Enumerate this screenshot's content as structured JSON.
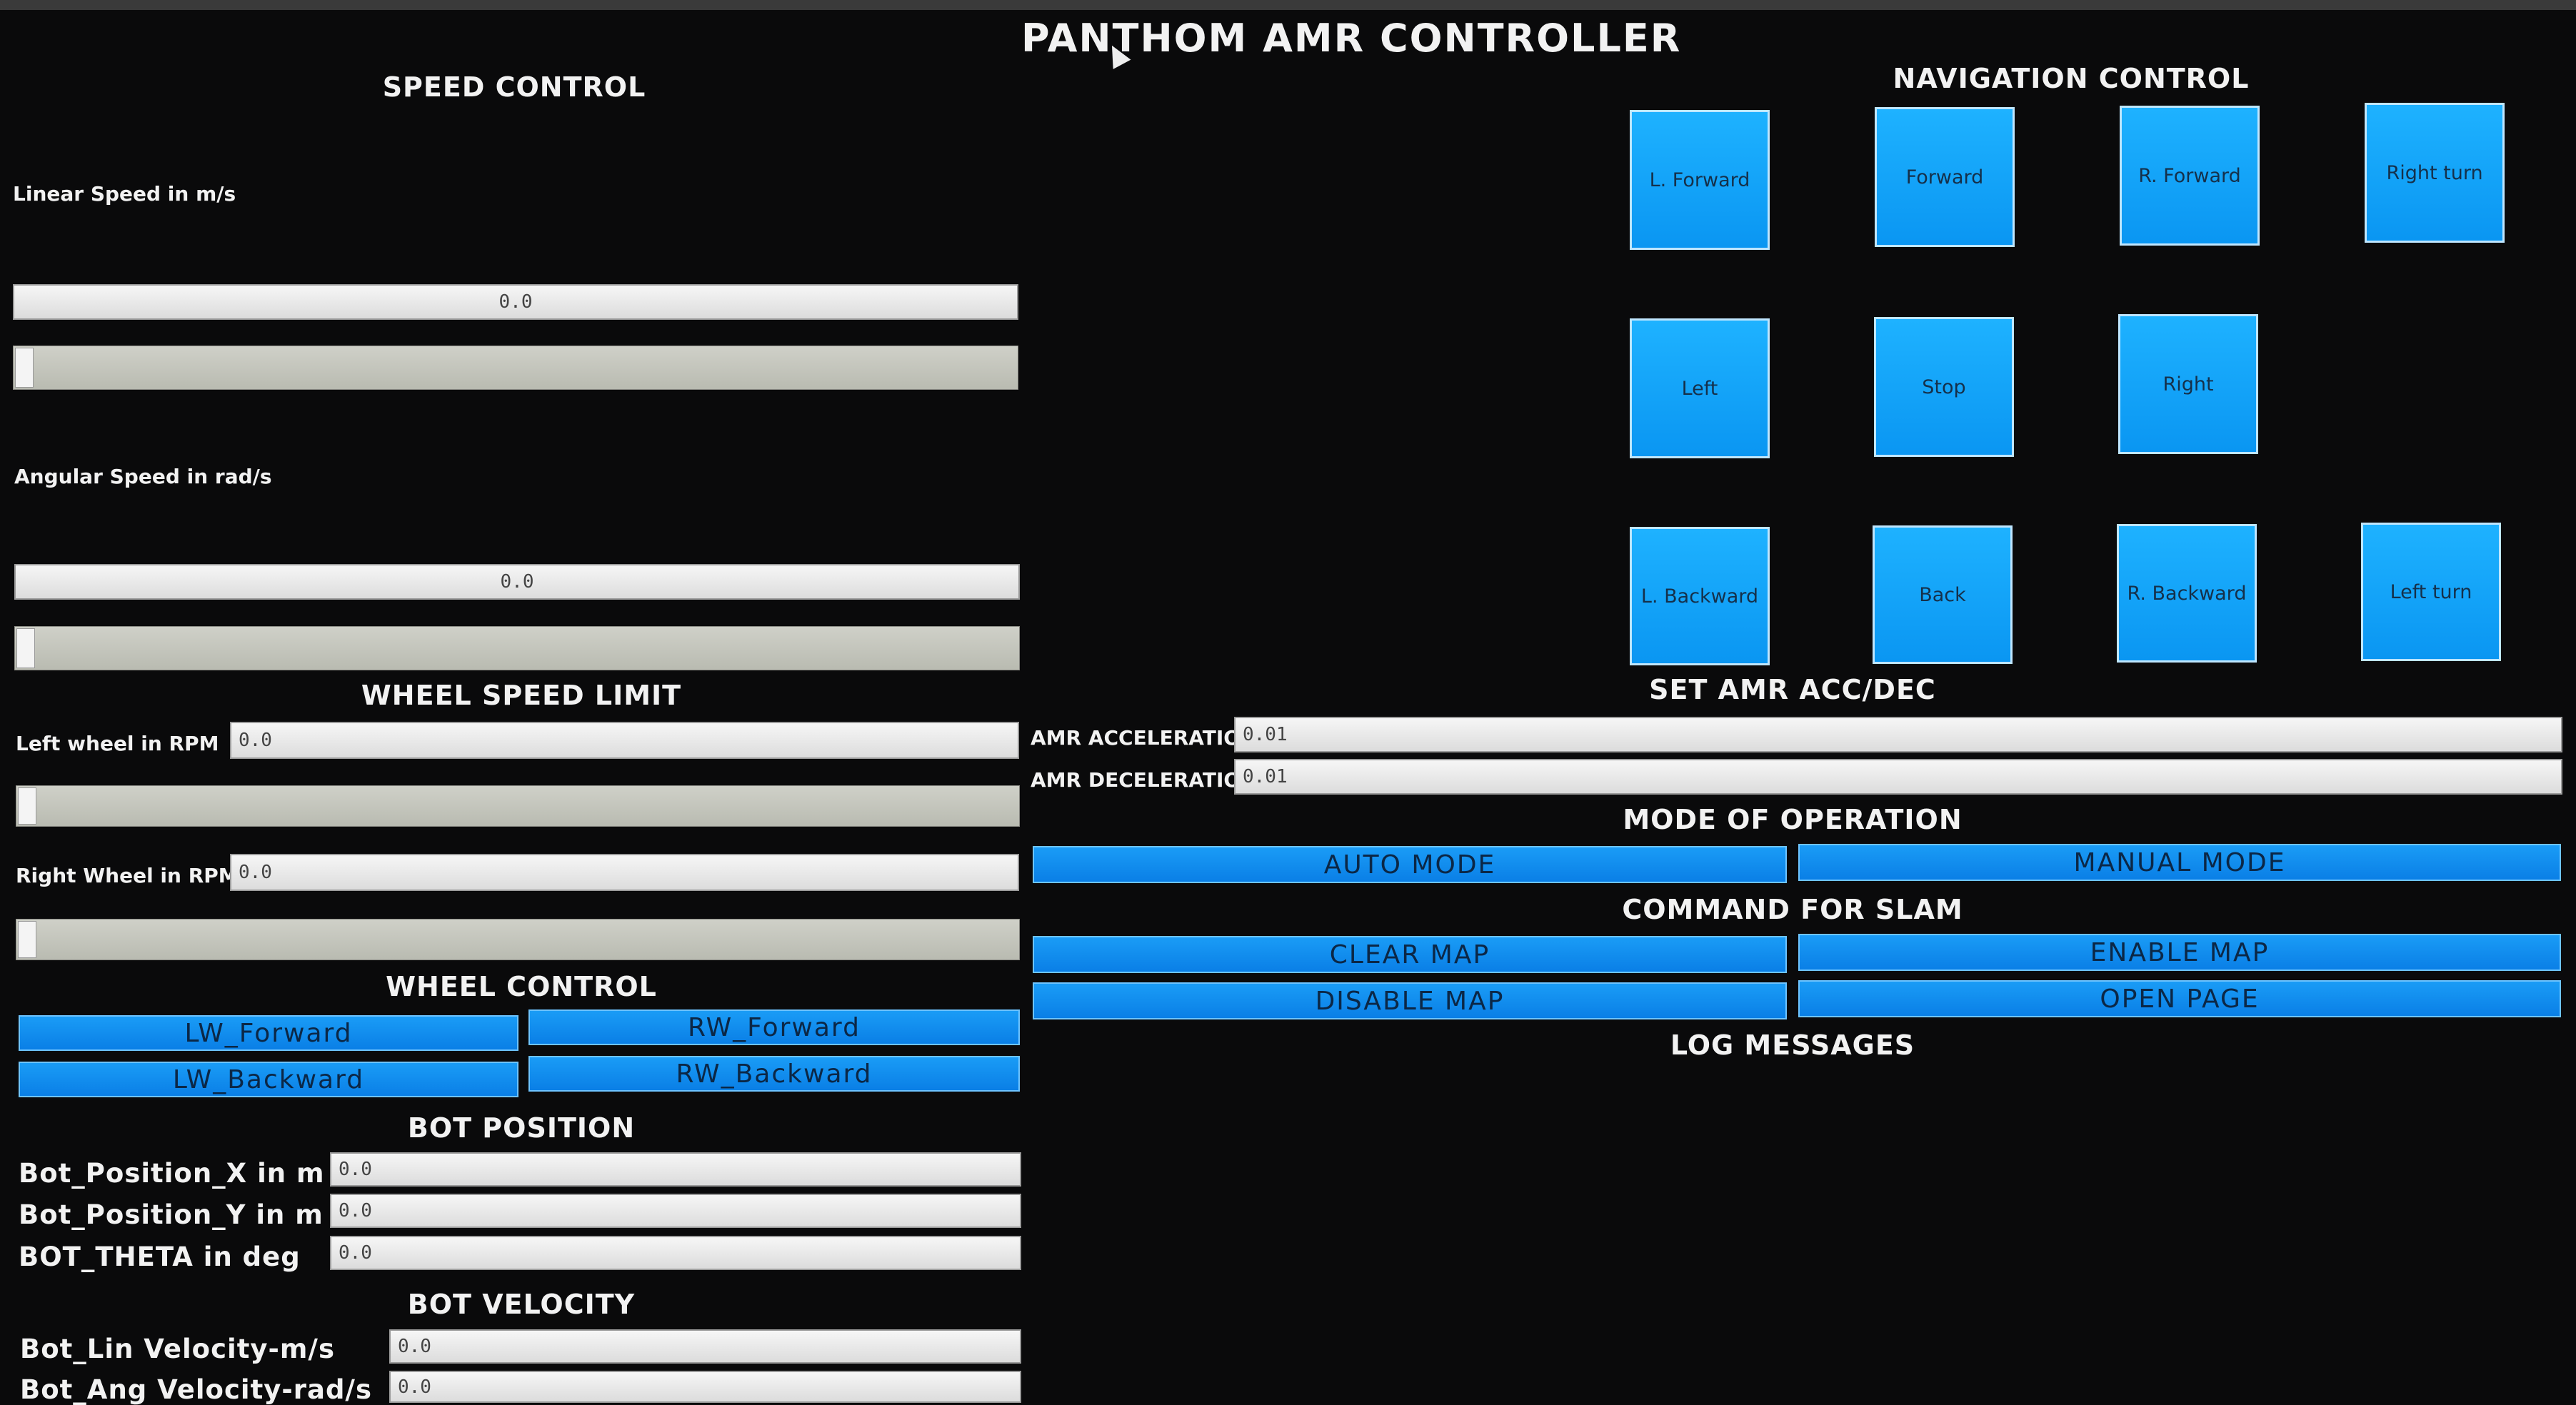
{
  "app": {
    "title": "PANTHOM AMR CONTROLLER"
  },
  "speed_control": {
    "heading": "SPEED CONTROL",
    "linear": {
      "label": "Linear Speed in m/s",
      "value": "0.0",
      "slider_fraction": 0.0
    },
    "angular": {
      "label": "Angular Speed in rad/s",
      "value": "0.0",
      "slider_fraction": 0.0
    }
  },
  "wheel_speed_limit": {
    "heading": "WHEEL SPEED LIMIT",
    "left": {
      "label": "Left wheel in RPM",
      "value": "0.0",
      "slider_fraction": 0.0
    },
    "right": {
      "label": "Right Wheel in RPM",
      "value": "0.0",
      "slider_fraction": 0.0
    }
  },
  "wheel_control": {
    "heading": "WHEEL CONTROL",
    "lw_forward": "LW_Forward",
    "rw_forward": "RW_Forward",
    "lw_backward": "LW_Backward",
    "rw_backward": "RW_Backward"
  },
  "bot_position": {
    "heading": "BOT POSITION",
    "x_label": "Bot_Position_X in m",
    "x_value": "0.0",
    "y_label": "Bot_Position_Y in m",
    "y_value": "0.0",
    "theta_label": "BOT_THETA in deg",
    "theta_value": "0.0"
  },
  "bot_velocity": {
    "heading": "BOT VELOCITY",
    "lin_label": "Bot_Lin Velocity-m/s",
    "lin_value": "0.0",
    "ang_label": "Bot_Ang Velocity-rad/s",
    "ang_value": "0.0"
  },
  "navigation": {
    "heading": "NAVIGATION CONTROL",
    "l_forward": "L. Forward",
    "forward": "Forward",
    "r_forward": "R. Forward",
    "right_turn": "Right turn",
    "left": "Left",
    "stop": "Stop",
    "right": "Right",
    "l_backward": "L. Backward",
    "back": "Back",
    "r_backward": "R. Backward",
    "left_turn": "Left turn"
  },
  "acc_dec": {
    "heading": "SET AMR ACC/DEC",
    "acc_label": "AMR ACCELERATION",
    "acc_value": "0.01",
    "dec_label": "AMR DECELERATION",
    "dec_value": "0.01"
  },
  "mode": {
    "heading": "MODE OF OPERATION",
    "auto": "AUTO MODE",
    "manual": "MANUAL MODE"
  },
  "slam": {
    "heading": "COMMAND FOR SLAM",
    "clear_map": "CLEAR MAP",
    "enable_map": "ENABLE MAP",
    "disable_map": "DISABLE MAP",
    "open_page": "OPEN PAGE"
  },
  "log": {
    "heading": "LOG MESSAGES"
  },
  "colors": {
    "button_blue": "#0a96f2",
    "background": "#0a0a0b",
    "text": "#f2f2f2"
  }
}
